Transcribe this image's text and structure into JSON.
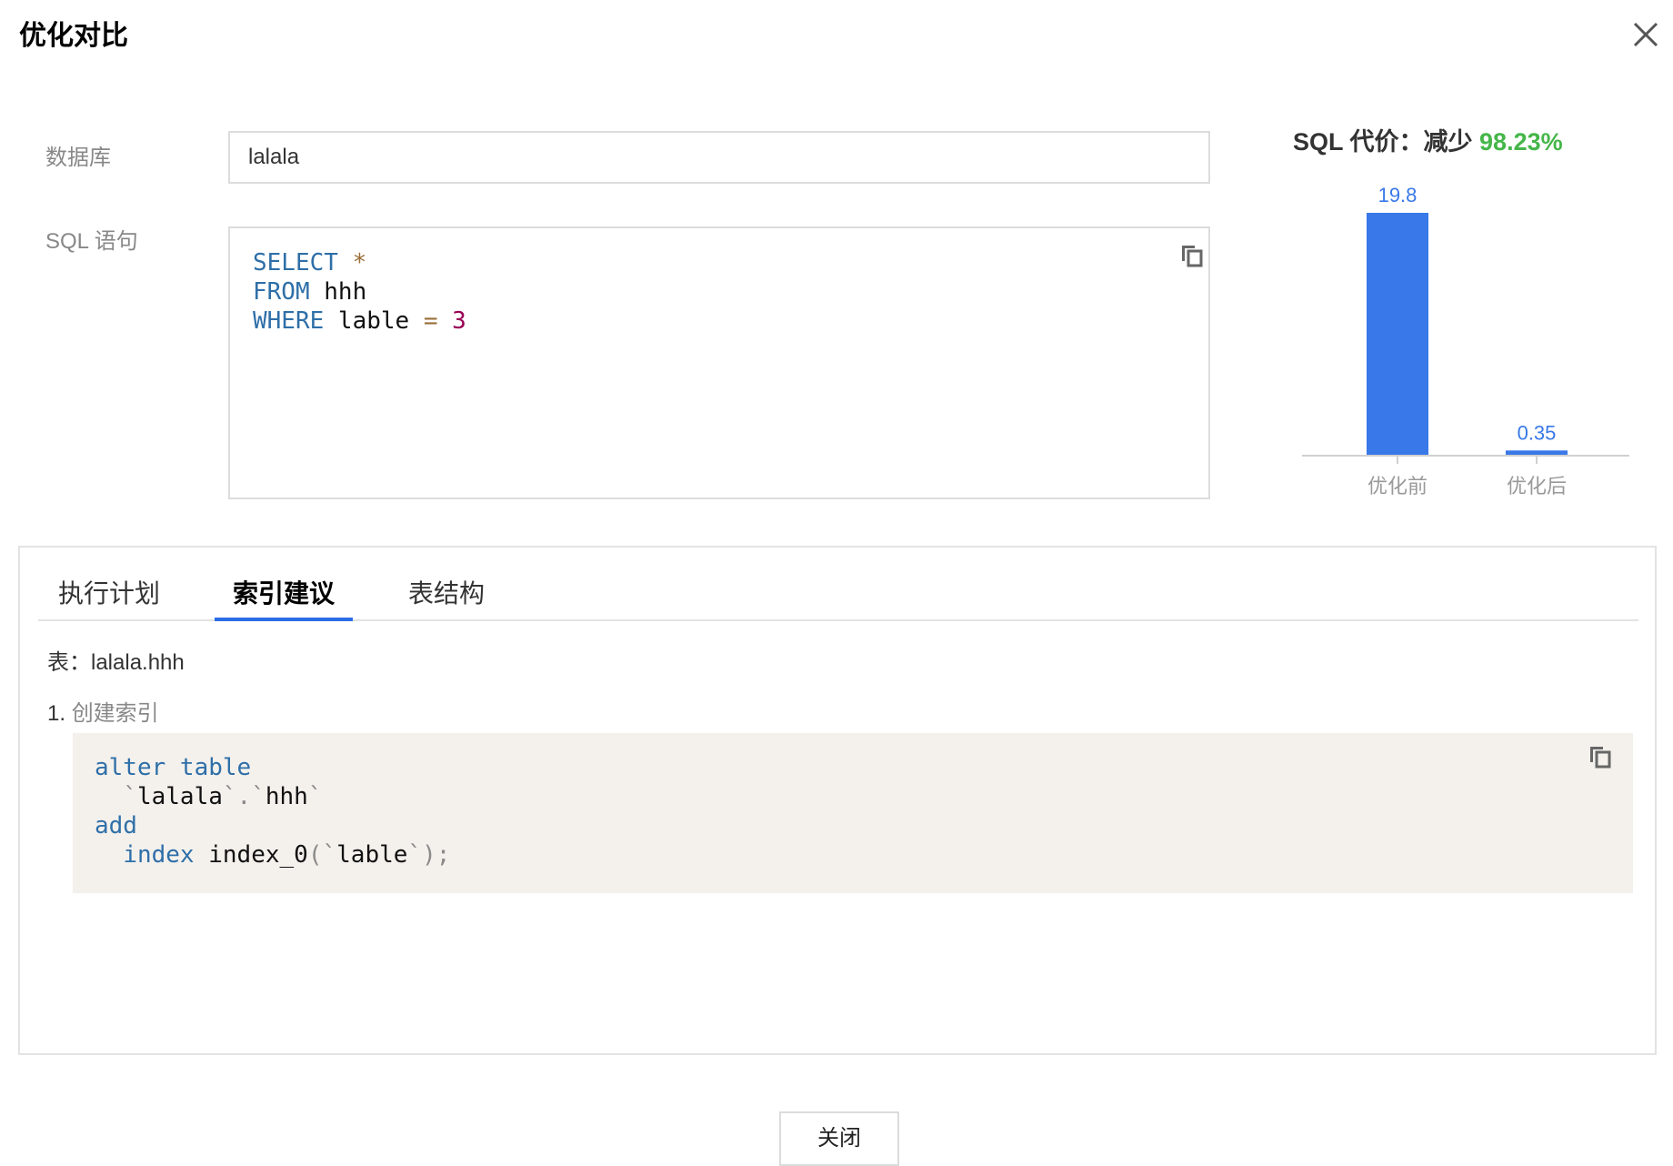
{
  "dialog": {
    "title": "优化对比",
    "close_label": "关闭"
  },
  "form": {
    "database_label": "数据库",
    "database_value": "lalala",
    "sql_label": "SQL 语句",
    "sql_lines": [
      [
        {
          "t": "SELECT",
          "c": "kw"
        },
        {
          "t": " ",
          "c": "id"
        },
        {
          "t": "*",
          "c": "op"
        }
      ],
      [
        {
          "t": "FROM",
          "c": "kw"
        },
        {
          "t": " hhh",
          "c": "id"
        }
      ],
      [
        {
          "t": "WHERE",
          "c": "kw"
        },
        {
          "t": " lable ",
          "c": "id"
        },
        {
          "t": "=",
          "c": "op"
        },
        {
          "t": " ",
          "c": "id"
        },
        {
          "t": "3",
          "c": "num"
        }
      ]
    ]
  },
  "cost": {
    "title_prefix": "SQL 代价：减少 ",
    "reduction_percent": "98.23%",
    "accent_color": "#45b649"
  },
  "chart_data": {
    "type": "bar",
    "categories": [
      "优化前",
      "优化后"
    ],
    "values": [
      19.8,
      0.35
    ],
    "data_labels": [
      "19.8",
      "0.35"
    ],
    "bar_color": "#3878e8",
    "label_color": "#3878e8",
    "title": "",
    "xlabel": "",
    "ylabel": "",
    "ylim": [
      0,
      19.8
    ],
    "grid": false,
    "legend": "none"
  },
  "tabs": [
    {
      "label": "执行计划",
      "active": false
    },
    {
      "label": "索引建议",
      "active": true
    },
    {
      "label": "表结构",
      "active": false
    }
  ],
  "index_suggestion": {
    "table_prefix": "表：",
    "table_name": "lalala.hhh",
    "item_number": "1.",
    "item_label": "创建索引",
    "sql_lines": [
      [
        {
          "t": "alter table",
          "c": "kw"
        }
      ],
      [
        {
          "t": "  ",
          "c": "id"
        },
        {
          "t": "`",
          "c": "punc"
        },
        {
          "t": "lalala",
          "c": "id"
        },
        {
          "t": "`.`",
          "c": "punc"
        },
        {
          "t": "hhh",
          "c": "id"
        },
        {
          "t": "`",
          "c": "punc"
        }
      ],
      [
        {
          "t": "add",
          "c": "kw"
        }
      ],
      [
        {
          "t": "  ",
          "c": "id"
        },
        {
          "t": "index",
          "c": "kw"
        },
        {
          "t": " index_0",
          "c": "id"
        },
        {
          "t": "(`",
          "c": "punc"
        },
        {
          "t": "lable",
          "c": "id"
        },
        {
          "t": "`);",
          "c": "punc"
        }
      ]
    ]
  },
  "colors": {
    "accent": "#2b6de6",
    "code_bg": "#f4f1ed",
    "keyword": "#2f6fa8"
  },
  "icons": {
    "close": "close-icon",
    "copy": "copy-icon"
  }
}
